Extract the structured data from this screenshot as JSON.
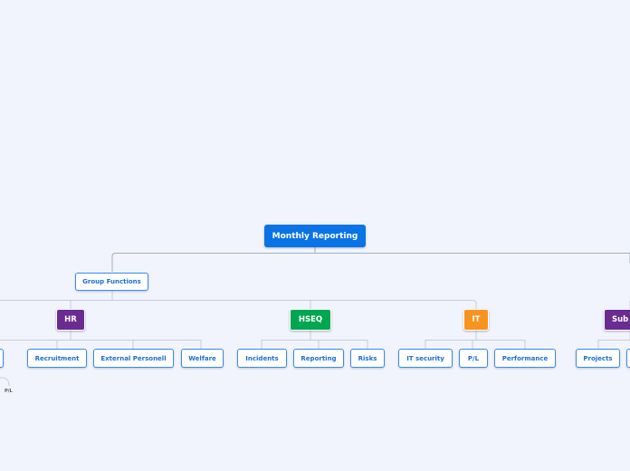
{
  "root": {
    "label": "Monthly Reporting",
    "color": "#0a73e6"
  },
  "group": {
    "label": "Group Functions"
  },
  "branches": [
    {
      "label": "HR",
      "color": "#6a2c91",
      "children": [
        "Recruitment",
        "External Personell",
        "Welfare"
      ]
    },
    {
      "label": "HSEQ",
      "color": "#00a650",
      "children": [
        "Incidents",
        "Reporting",
        "Risks"
      ]
    },
    {
      "label": "IT",
      "color": "#f7931e",
      "children": [
        "IT security",
        "P/L",
        "Performance"
      ]
    },
    {
      "label": "Sub",
      "color": "#6a2c91",
      "children": [
        "Projects"
      ]
    }
  ],
  "offscreen_left": {
    "sub_label": "P/L"
  }
}
